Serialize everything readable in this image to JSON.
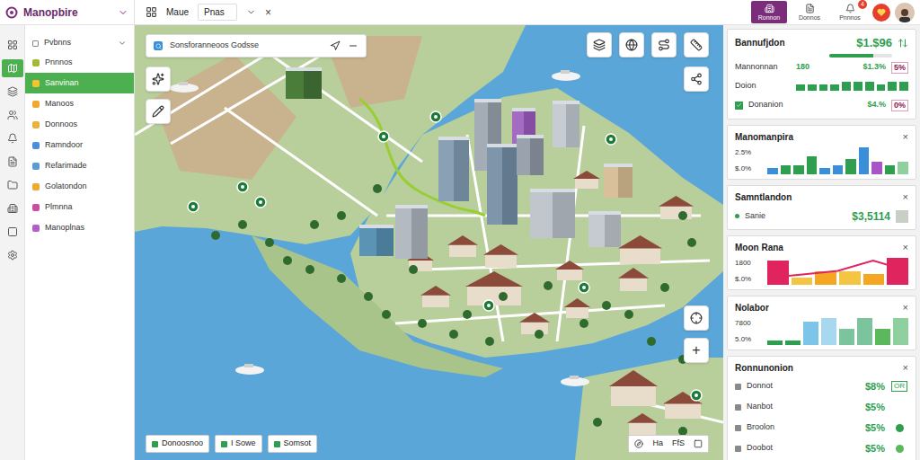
{
  "app": {
    "title": "Manopbire"
  },
  "toolbar": {
    "items": [
      {
        "label": "Maue",
        "kind": "text"
      },
      {
        "label": "Pnas",
        "kind": "field"
      }
    ],
    "close": "×"
  },
  "header_tabs": [
    {
      "label": "Ronnon",
      "selected": true
    },
    {
      "label": "Donnos",
      "selected": false
    },
    {
      "label": "Pnnnos",
      "selected": false,
      "badge": "4"
    }
  ],
  "rail": [
    {
      "selected": false
    },
    {
      "selected": true
    },
    {
      "selected": false
    },
    {
      "selected": false
    },
    {
      "selected": false
    },
    {
      "selected": false
    },
    {
      "selected": false
    },
    {
      "selected": false
    },
    {
      "selected": false
    },
    {
      "selected": false
    }
  ],
  "sidebar": {
    "title": "Pvbnns",
    "expanded": true,
    "items": [
      {
        "label": "Pnnnos",
        "selected": false,
        "color": "#a3b83b"
      },
      {
        "label": "Sanvinan",
        "selected": true,
        "color": "#f4c430"
      },
      {
        "label": "Manoos",
        "selected": false,
        "color": "#f0a830"
      },
      {
        "label": "Donnoos",
        "selected": false,
        "color": "#e8b33a"
      },
      {
        "label": "Ramndoor",
        "selected": false,
        "color": "#4a90d9"
      },
      {
        "label": "Refarimade",
        "selected": false,
        "color": "#5b9bd5"
      },
      {
        "label": "Golatondon",
        "selected": false,
        "color": "#f0a830"
      },
      {
        "label": "Plmnna",
        "selected": false,
        "color": "#c94fa3"
      },
      {
        "label": "Manoplnas",
        "selected": false,
        "color": "#b05fc4"
      }
    ]
  },
  "map": {
    "search": "Sonsforanneoos Godsse",
    "zoom_in": "+",
    "layers": [
      "Donoosnoo",
      "I Sowe",
      "Somsot"
    ],
    "status": [
      "Ha",
      "FfS"
    ]
  },
  "cards": [
    {
      "kind": "summary",
      "title": "Bannufjdon",
      "value": "$1.$96",
      "level": 0.7,
      "rows": [
        {
          "label": "Mannonnan",
          "value": "180",
          "reading": "$1.3%",
          "extra": "5%"
        },
        {
          "label": "Doion",
          "bars": [
            2,
            2,
            2,
            2,
            3,
            3,
            3,
            2,
            3,
            3
          ]
        },
        {
          "label": "Donanion",
          "checked": true,
          "reading": "$4.%",
          "extra": "0%"
        }
      ]
    },
    {
      "kind": "chart",
      "title": "Manomanpira",
      "close": "×",
      "ticks": [
        "2.5%",
        "$.0%"
      ],
      "values": [
        2,
        3,
        3,
        6,
        2,
        3,
        5,
        9,
        4,
        3,
        4
      ],
      "colors": [
        "#3b8fd9",
        "#2e9e4f",
        "#2e9e4f",
        "#2e9e4f",
        "#3b8fd9",
        "#3b8fd9",
        "#2e9e4f",
        "#3b8fd9",
        "#a855c7",
        "#2e9e4f",
        "#8fd19e"
      ]
    },
    {
      "kind": "stat",
      "title": "Samntlandon",
      "close": "×",
      "label": "Sanie",
      "value": "$3,5114"
    },
    {
      "kind": "chart",
      "title": "Moon Rana",
      "close": "×",
      "ticks": [
        "1800",
        "$.0%"
      ],
      "values": [
        7,
        2,
        4,
        4,
        3,
        8
      ],
      "colors": [
        "#e0245e",
        "#f4c542",
        "#f5a623",
        "#f4c542",
        "#f5a623",
        "#e0245e"
      ],
      "line": [
        2,
        3,
        4,
        7,
        4
      ]
    },
    {
      "kind": "chart",
      "title": "Nolabor",
      "close": "×",
      "ticks": [
        "7800",
        "5.0%"
      ],
      "values": [
        1,
        1,
        6,
        7,
        4,
        7,
        4,
        7
      ],
      "colors": [
        "#2e9e4f",
        "#2e9e4f",
        "#7cc4e8",
        "#a8d8f0",
        "#7cc49e",
        "#7cc49e",
        "#5cb85c",
        "#8fd19e"
      ]
    },
    {
      "kind": "list",
      "title": "Ronnunonion",
      "close": "×",
      "rows": [
        {
          "label": "Donnot",
          "value": "$8%",
          "mark": "OR"
        },
        {
          "label": "Nanbot",
          "value": "$5%"
        },
        {
          "label": "Broolon",
          "value": "$5%",
          "color": "#2e9e4f"
        },
        {
          "label": "Doobot",
          "value": "$5%",
          "color": "#5cb85c"
        }
      ]
    }
  ]
}
